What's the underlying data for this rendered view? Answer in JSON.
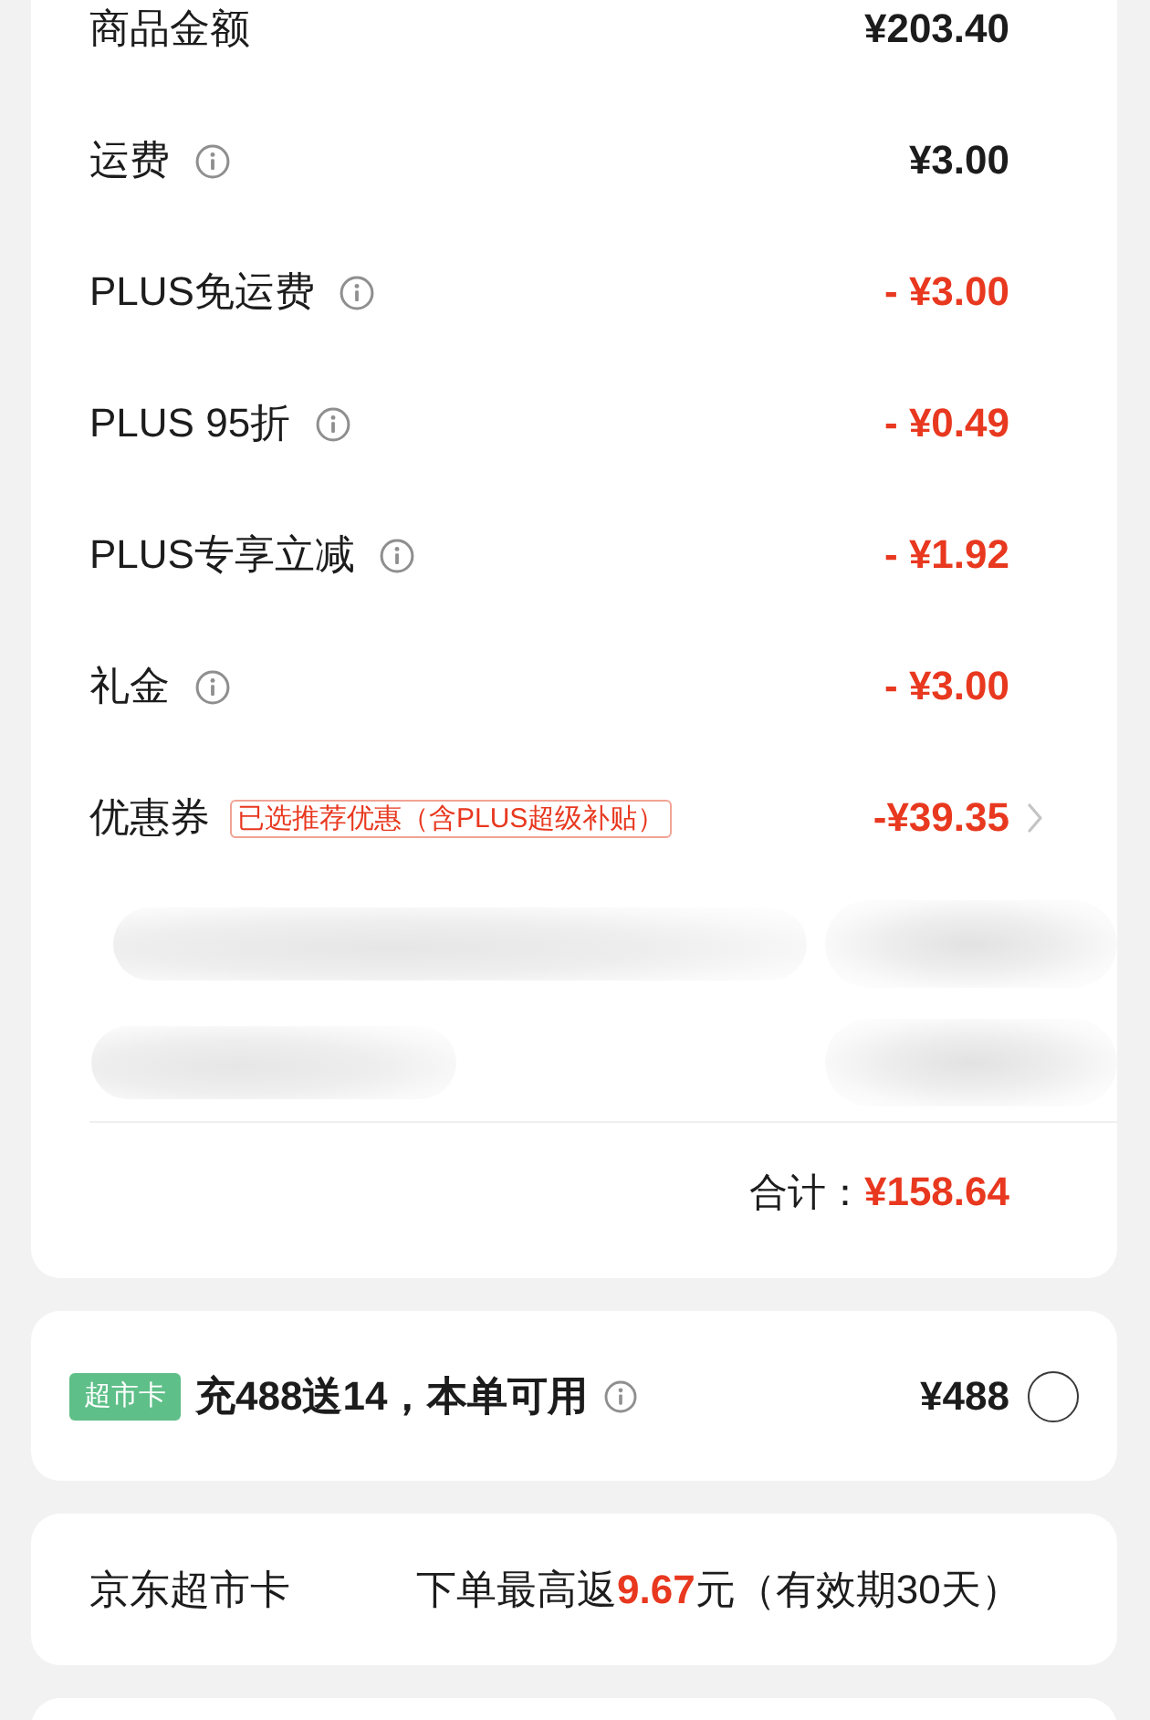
{
  "summary": {
    "rows": [
      {
        "kind": "amount",
        "label": "商品金额",
        "info": false,
        "discount": false,
        "value": "¥203.40",
        "arrow": false
      },
      {
        "kind": "amount",
        "label": "运费",
        "info": true,
        "discount": false,
        "value": "¥3.00",
        "arrow": false
      },
      {
        "kind": "amount",
        "label": "PLUS免运费",
        "info": true,
        "discount": true,
        "value": "- ¥3.00",
        "arrow": false
      },
      {
        "kind": "amount",
        "label": "PLUS 95折",
        "info": true,
        "discount": true,
        "value": "- ¥0.49",
        "arrow": false
      },
      {
        "kind": "amount",
        "label": "PLUS专享立减",
        "info": true,
        "discount": true,
        "value": "- ¥1.92",
        "arrow": false
      },
      {
        "kind": "amount",
        "label": "礼金",
        "info": true,
        "discount": true,
        "value": "- ¥3.00",
        "arrow": false
      },
      {
        "kind": "amount",
        "label": "优惠券",
        "info": false,
        "tag": "已选推荐优惠（含PLUS超级补贴）",
        "discount": true,
        "value": "-¥39.35",
        "arrow": true
      },
      {
        "kind": "blurred"
      },
      {
        "kind": "blurred"
      }
    ],
    "total": {
      "label": "合计：",
      "value": "¥158.64"
    }
  },
  "supermarket_offer": {
    "badge": "超市卡",
    "text": "充488送14，本单可用",
    "info": true,
    "price": "¥488",
    "selected": false
  },
  "supermarket_card": {
    "label": "京东超市卡",
    "text_before": "下单最高返",
    "amount": "9.67",
    "text_after": "元（有效期30天）"
  }
}
